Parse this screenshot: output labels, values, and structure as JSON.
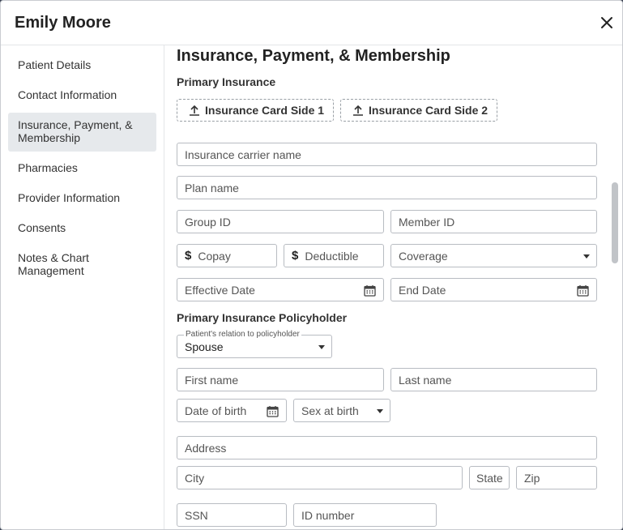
{
  "header": {
    "title": "Emily Moore",
    "close_icon": "close-icon"
  },
  "sidebar": {
    "items": [
      {
        "label": "Patient Details",
        "active": false
      },
      {
        "label": "Contact Information",
        "active": false
      },
      {
        "label": "Insurance, Payment, & Membership",
        "active": true
      },
      {
        "label": "Pharmacies",
        "active": false
      },
      {
        "label": "Provider Information",
        "active": false
      },
      {
        "label": "Consents",
        "active": false
      },
      {
        "label": "Notes & Chart Management",
        "active": false
      }
    ]
  },
  "main": {
    "section_title": "Insurance, Payment, & Membership",
    "primary_insurance": {
      "heading": "Primary Insurance",
      "upload_side1": "Insurance Card Side 1",
      "upload_side2": "Insurance Card Side 2",
      "carrier_placeholder": "Insurance carrier name",
      "plan_placeholder": "Plan name",
      "group_id_placeholder": "Group ID",
      "member_id_placeholder": "Member ID",
      "copay_placeholder": "Copay",
      "deductible_placeholder": "Deductible",
      "coverage_placeholder": "Coverage",
      "effective_date_placeholder": "Effective Date",
      "end_date_placeholder": "End Date",
      "currency_symbol": "$"
    },
    "policyholder": {
      "heading": "Primary Insurance Policyholder",
      "relation_label": "Patient's relation to policyholder",
      "relation_value": "Spouse",
      "first_name_placeholder": "First name",
      "last_name_placeholder": "Last name",
      "dob_placeholder": "Date of birth",
      "sex_placeholder": "Sex at birth",
      "address_placeholder": "Address",
      "city_placeholder": "City",
      "state_placeholder": "State",
      "zip_placeholder": "Zip",
      "ssn_placeholder": "SSN",
      "id_number_placeholder": "ID number"
    }
  },
  "colors": {
    "active_nav_bg": "#e6e9ec",
    "border": "#b8bcc2",
    "text": "#333333"
  }
}
